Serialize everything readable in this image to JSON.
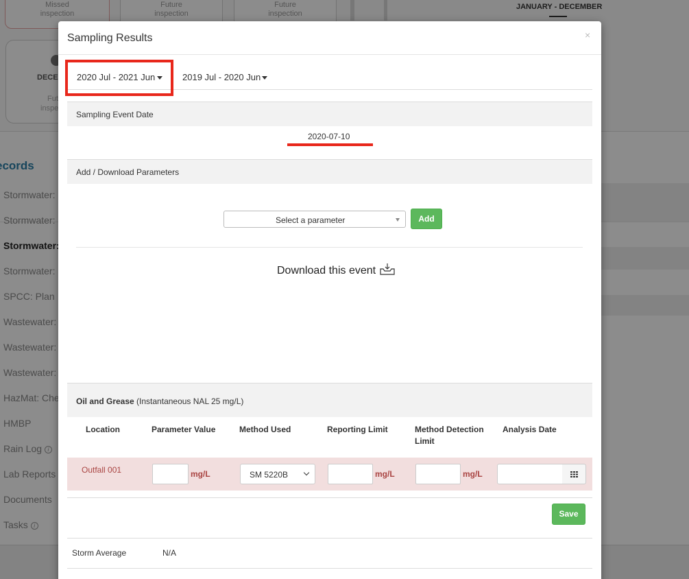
{
  "background": {
    "cards": [
      {
        "line1": "Missed",
        "line2": "inspection"
      },
      {
        "line1": "Future",
        "line2": "inspection"
      },
      {
        "line1": "Future",
        "line2": "inspection"
      }
    ],
    "year_label": "JANUARY - DECEMBER",
    "dec_card": {
      "label": "DECEI",
      "sub1": "Fut",
      "sub2": "inspe"
    },
    "records_heading": "ecords",
    "sidebar_items": [
      {
        "label": "Stormwater:"
      },
      {
        "label": "Stormwater:"
      },
      {
        "label": "Stormwater:",
        "active": true
      },
      {
        "label": "Stormwater:"
      },
      {
        "label": "SPCC: Plan"
      },
      {
        "label": "Wastewater:"
      },
      {
        "label": "Wastewater:"
      },
      {
        "label": "Wastewater:"
      },
      {
        "label": "HazMat: Che"
      },
      {
        "label": "HMBP"
      },
      {
        "label": "Rain Log",
        "info": "i"
      },
      {
        "label": "Lab Reports"
      },
      {
        "label": "Documents"
      },
      {
        "label": "Tasks",
        "info": "i"
      }
    ]
  },
  "modal": {
    "title": "Sampling Results",
    "close": "×",
    "tabs": [
      {
        "label": "2020 Jul - 2021 Jun",
        "active": true
      },
      {
        "label": "2019 Jul - 2020 Jun",
        "active": false
      }
    ],
    "sampling_event": {
      "label": "Sampling Event Date",
      "date": "2020-07-10"
    },
    "parameters": {
      "label": "Add / Download Parameters",
      "select_placeholder": "Select a parameter",
      "add_button": "Add",
      "download_label": "Download this event"
    },
    "parameter_block": {
      "name": "Oil and Grease",
      "nal": "(Instantaneous NAL 25 mg/L)",
      "columns": [
        "Location",
        "Parameter Value",
        "Method Used",
        "Reporting Limit",
        "Method Detection",
        "Limit",
        "Analysis Date"
      ],
      "row": {
        "location": "Outfall 001",
        "unit": "mg/L",
        "method": "SM 5220B"
      },
      "save_button": "Save"
    },
    "storm_average": {
      "label": "Storm Average",
      "value": "N/A"
    }
  },
  "colors": {
    "accent_green": "#5cb85c",
    "highlight_red": "#e8271b",
    "error_text": "#a94442",
    "error_bg": "#f2dede"
  }
}
